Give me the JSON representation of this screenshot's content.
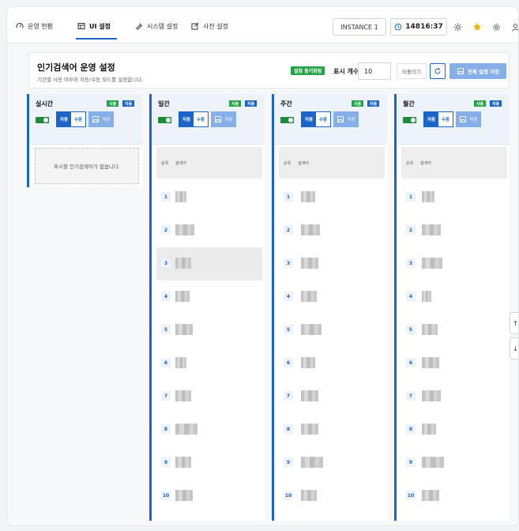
{
  "nav": {
    "tabs": [
      {
        "label": "운영 현황",
        "icon": "gauge-icon"
      },
      {
        "label": "UI 설정",
        "icon": "layout-icon",
        "active": true
      },
      {
        "label": "시스템 설정",
        "icon": "wrench-icon"
      },
      {
        "label": "사전 설정",
        "icon": "edit-icon"
      }
    ],
    "instance": "INSTANCE 1",
    "clock": "14816:37",
    "icons": [
      "sun-icon",
      "star-icon",
      "gear-icon",
      "user-icon"
    ]
  },
  "header": {
    "title": "인기검색어 운영 설정",
    "subtitle": "기간별 사용 여부와 자동/수동 모드를 설정합니다.",
    "badge": "설정 용기화됨",
    "count_label": "표시 개수",
    "count_value": "10",
    "revert_label": "되돌리기",
    "save_all_label": "전체 설정 저장"
  },
  "colors": {
    "accent": "#1d64c9",
    "success": "#22a347",
    "save": "#86aee8"
  },
  "columns": [
    {
      "title": "실시간",
      "tags": [
        "사용",
        "자동"
      ],
      "seg": [
        "자동",
        "수동"
      ],
      "save_label": "저장",
      "empty_text": "표시할 인기검색어가 없습니다."
    },
    {
      "title": "일간",
      "tags": [
        "사용",
        "자동"
      ],
      "seg": [
        "자동",
        "수동"
      ],
      "save_label": "저장",
      "headers": [
        "순위",
        "검색어"
      ],
      "rows": [
        "1",
        "2",
        "3",
        "4",
        "5",
        "6",
        "7",
        "8",
        "9",
        "10"
      ]
    },
    {
      "title": "주간",
      "tags": [
        "사용",
        "자동"
      ],
      "seg": [
        "자동",
        "수동"
      ],
      "save_label": "저장",
      "headers": [
        "순위",
        "검색어"
      ],
      "rows": [
        "1",
        "2",
        "3",
        "4",
        "5",
        "6",
        "7",
        "8",
        "9",
        "10"
      ]
    },
    {
      "title": "월간",
      "tags": [
        "사용",
        "자동"
      ],
      "seg": [
        "자동",
        "수동"
      ],
      "save_label": "저장",
      "headers": [
        "순위",
        "검색어"
      ],
      "rows": [
        "1",
        "2",
        "3",
        "4",
        "5",
        "6",
        "7",
        "8",
        "9",
        "10"
      ]
    }
  ],
  "side_buttons": [
    "↑",
    "↓"
  ]
}
